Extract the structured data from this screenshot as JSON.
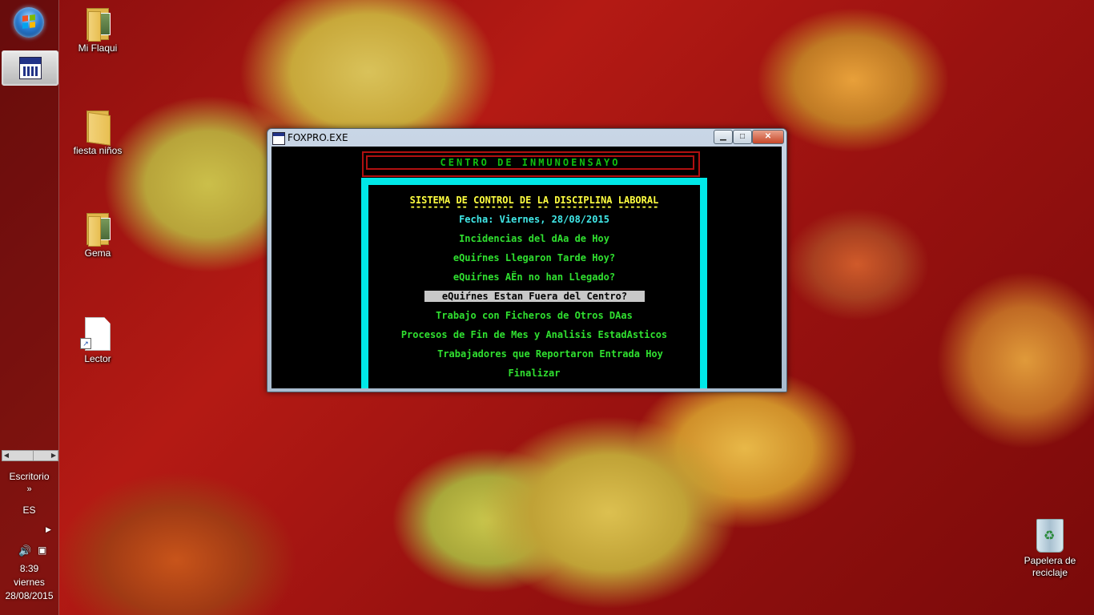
{
  "taskbar": {
    "task_app": "FOXPRO.EXE",
    "desktop_toolbar_label": "Escritorio",
    "language": "ES",
    "time": "8:39",
    "weekday": "viernes",
    "date": "28/08/2015"
  },
  "desktop": {
    "icons": [
      {
        "label": "Mi Flaqui"
      },
      {
        "label": "fiesta niños"
      },
      {
        "label": "Gema"
      },
      {
        "label": "Lector"
      },
      {
        "label": "Papelera de reciclaje"
      }
    ]
  },
  "window": {
    "title": "FOXPRO.EXE",
    "header": "CENTRO DE INMUNOENSAYO",
    "menu": {
      "title": "SISTEMA DE CONTROL DE LA DISCIPLINA LABORAL",
      "underline": "------- -- ------- -- -- ---------- -------",
      "date": "Fecha: Viernes, 28/08/2015",
      "items": [
        "Incidencias del dAa de Hoy",
        "eQuiŕnes Llegaron Tarde Hoy?",
        "eQuiŕnes AЁn no han Llegado?",
        "eQuiŕnes Estan Fuera del Centro?",
        "Trabajo con Ficheros de Otros DAas",
        "Procesos de Fin de Mes y Analisis EstadAsticos",
        "Trabajadores que Reportaron Entrada Hoy",
        "Finalizar"
      ]
    }
  }
}
